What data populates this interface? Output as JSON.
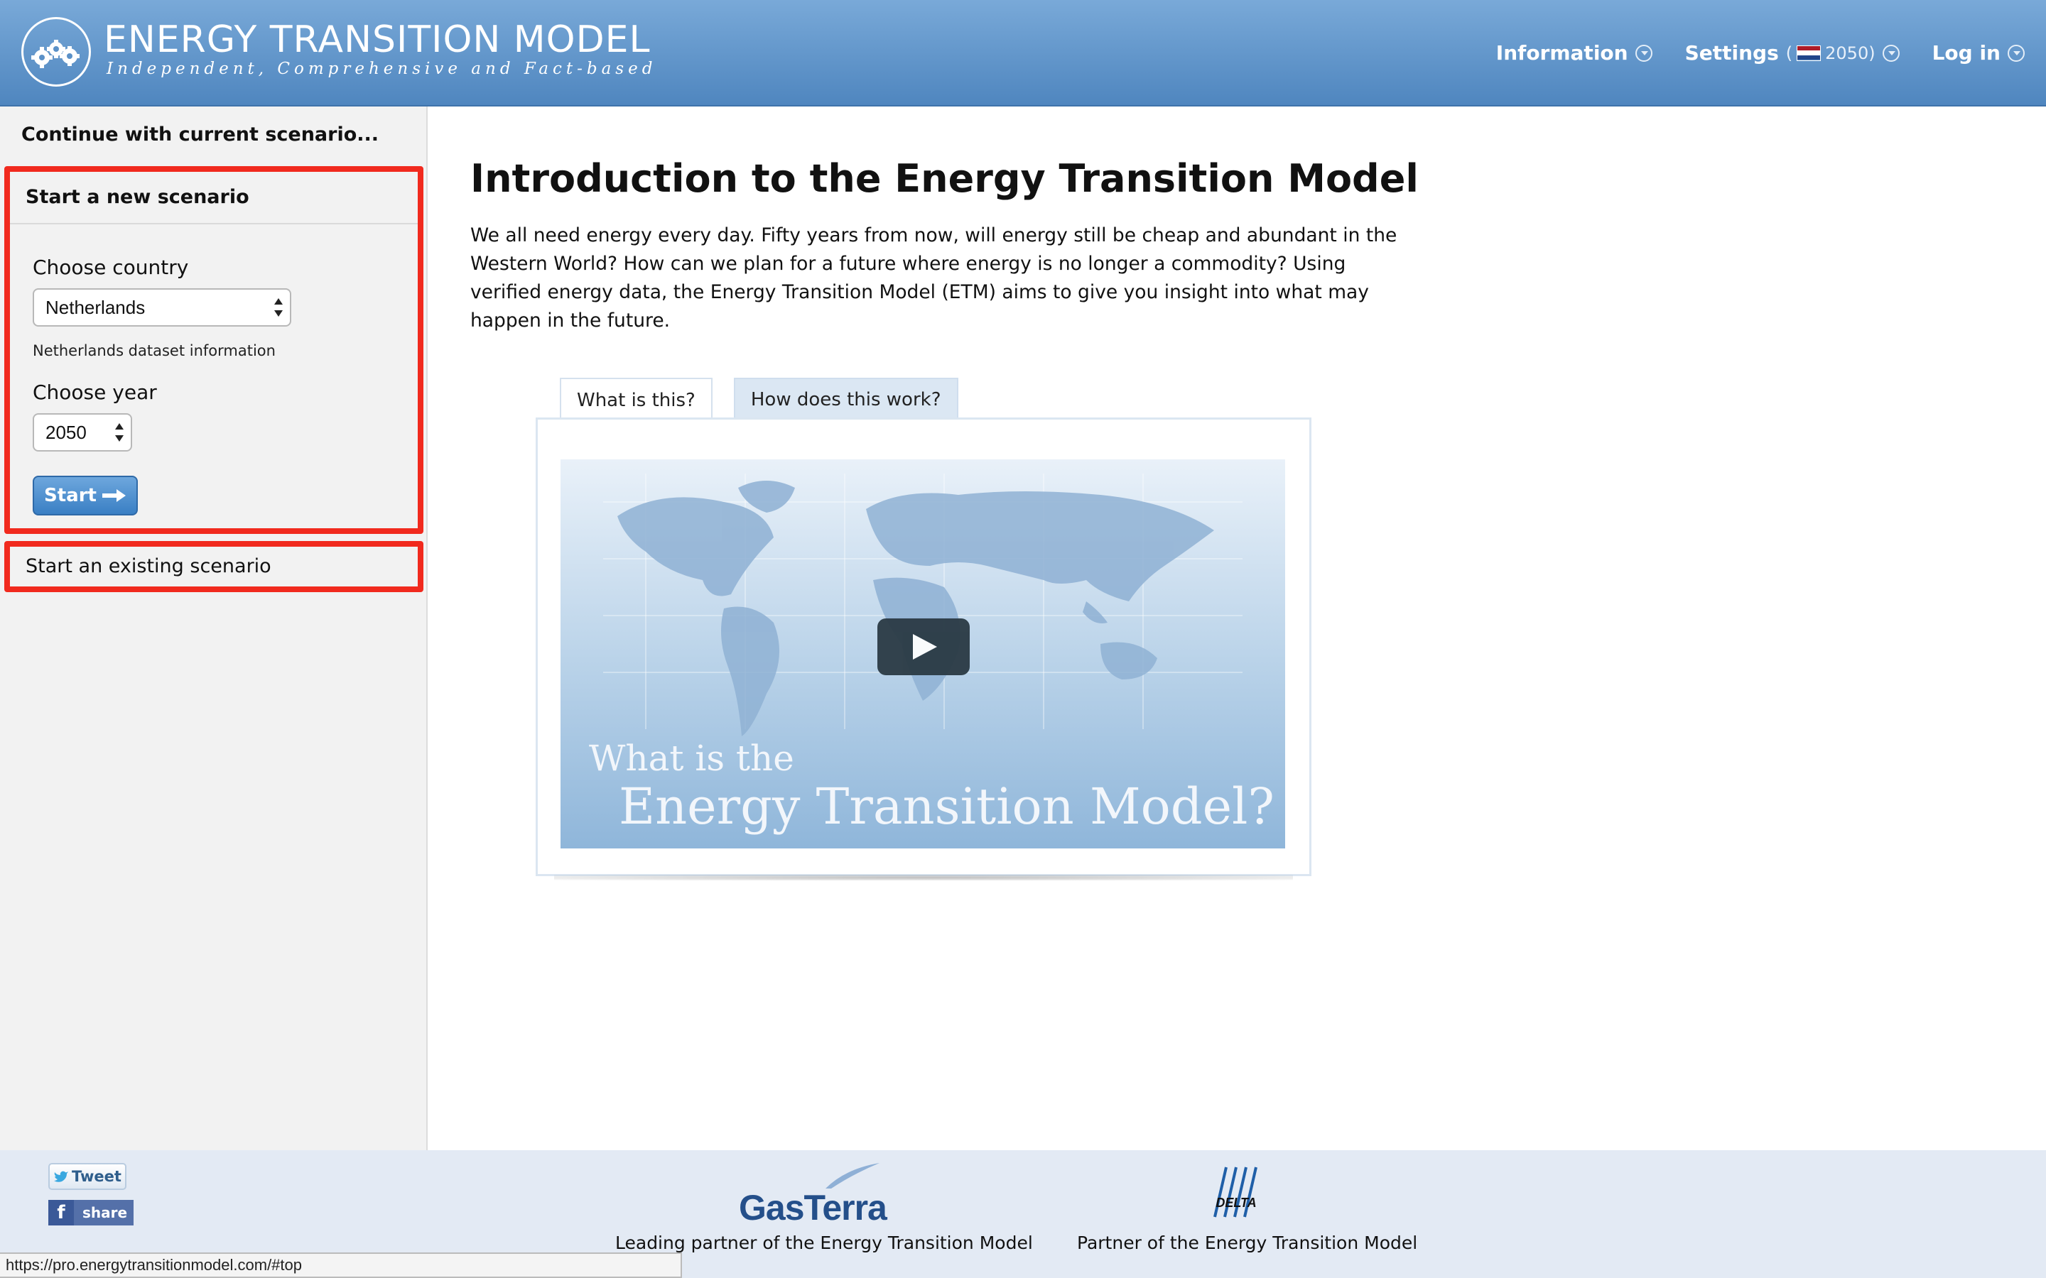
{
  "header": {
    "title": "ENERGY TRANSITION MODEL",
    "tagline": "Independent, Comprehensive and Fact-based",
    "nav": {
      "information": "Information",
      "settings": "Settings",
      "settings_year": "2050",
      "login": "Log in"
    }
  },
  "sidebar": {
    "continue_label": "Continue with current scenario...",
    "new_scenario": {
      "title": "Start a new scenario",
      "country_label": "Choose country",
      "country_value": "Netherlands",
      "dataset_info": "Netherlands dataset information",
      "year_label": "Choose year",
      "year_value": "2050",
      "start_label": "Start"
    },
    "existing_label": "Start an existing scenario"
  },
  "main": {
    "title": "Introduction to the Energy Transition Model",
    "intro": "We all need energy every day. Fifty years from now, will energy still be cheap and abundant in the Western World? How can we plan for a future where energy is no longer a commodity? Using verified energy data, the Energy Transition Model (ETM) aims to give you insight into what may happen in the future.",
    "tabs": [
      {
        "label": "What is this?",
        "active": true
      },
      {
        "label": "How does this work?",
        "active": false
      }
    ],
    "video": {
      "line1": "What is the",
      "line2": "Energy Transition Model?"
    }
  },
  "footer": {
    "tweet_label": "Tweet",
    "share_label": "share",
    "gasterra_logo_text": "GasTerra",
    "partner1": "Leading partner of the Energy Transition Model",
    "delta_logo_text": "DELTA",
    "partner2": "Partner of the Energy Transition Model"
  },
  "status_url": "https://pro.energytransitionmodel.com/#top",
  "colors": {
    "header": "#5b91c8",
    "highlight_border": "#f12a1e",
    "start_button": "#4a8ccf",
    "footer": "#e3eaf4"
  },
  "icons": [
    "gears-icon",
    "chevron-down-icon",
    "netherlands-flag-icon",
    "arrow-right-icon",
    "play-icon",
    "twitter-icon",
    "facebook-icon"
  ]
}
